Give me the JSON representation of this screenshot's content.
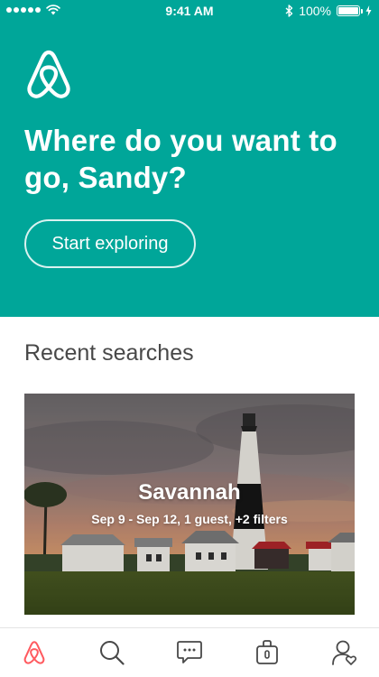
{
  "status_bar": {
    "time": "9:41 AM",
    "battery": "100%",
    "signal_bars": 5,
    "battery_level": 1.0
  },
  "hero": {
    "title": "Where do you want to go, Sandy?",
    "button_label": "Start exploring",
    "background_color": "#00a699",
    "logo_icon": "airbnb-belo-icon"
  },
  "recent": {
    "title": "Recent searches",
    "card": {
      "city": "Savannah",
      "details": "Sep 9 - Sep 12, 1 guest, +2 filters"
    }
  },
  "tab_bar": {
    "accent_color": "#ff5a5f",
    "inactive_color": "#484848",
    "tabs": [
      {
        "icon": "airbnb-logo-icon",
        "active": true
      },
      {
        "icon": "search-icon",
        "active": false
      },
      {
        "icon": "messages-icon",
        "active": false
      },
      {
        "icon": "trips-icon",
        "active": false
      },
      {
        "icon": "profile-icon",
        "active": false
      }
    ]
  }
}
